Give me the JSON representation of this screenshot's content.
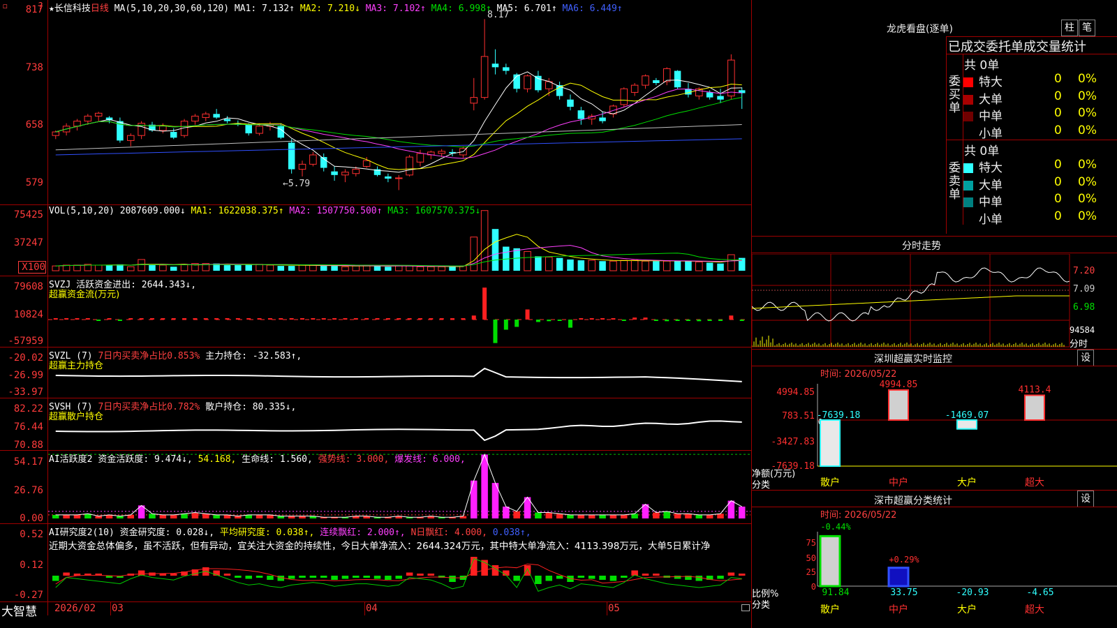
{
  "stock": {
    "name": "长信科技",
    "period": "日线",
    "star": "★",
    "peak_label": "8.17",
    "low_label": "5.79"
  },
  "ma": {
    "label": "MA(5,10,20,30,60,120)",
    "ma1": "MA1: 7.132↑",
    "ma2": "MA2: 7.210↓",
    "ma3": "MA3: 7.102↑",
    "ma4": "MA4: 6.998↑",
    "ma5": "MA5: 6.701↑",
    "ma6": "MA6: 6.449↑"
  },
  "price_axis": [
    "817",
    "738",
    "658",
    "579"
  ],
  "vol": {
    "label": "VOL(5,10,20)",
    "value": "2087609.000↓",
    "ma1": "MA1: 1622038.375↑",
    "ma2": "MA2: 1507750.500↑",
    "ma3": "MA3: 1607570.375↓",
    "axis": [
      "75425",
      "37247",
      "X100"
    ]
  },
  "svzj": {
    "label": "SVZJ",
    "desc": "活跃资金进出: 2644.343↓,",
    "sub": "超赢资金流(万元)",
    "axis": [
      "79608",
      "10824",
      "-57959"
    ]
  },
  "svzl": {
    "label": "SVZL  (7)",
    "ratio": "7日内买卖净占比0.853%",
    "hold": "主力持仓: -32.583↑,",
    "sub": "超赢主力持仓",
    "axis": [
      "-20.02",
      "-26.99",
      "-33.97"
    ]
  },
  "svsh": {
    "label": "SVSH  (7)",
    "ratio": "7日内买卖净占比0.782%",
    "hold": "散户持仓: 80.335↓,",
    "sub": "超赢散户持仓",
    "axis": [
      "82.22",
      "76.44",
      "70.88"
    ]
  },
  "ai_act": {
    "label": "AI活跃度2",
    "a": "资金活跃度: 9.474↓,",
    "b": "54.168,",
    "c": "生命线: 1.560,",
    "d": "强势线: 3.000,",
    "e": "爆发线: 6.000,",
    "axis": [
      "54.17",
      "26.76",
      "0.00"
    ]
  },
  "ai_res": {
    "label": "AI研究度2(10)",
    "a": "资金研究度: 0.028↓,",
    "b": "平均研究度: 0.038↑,",
    "c": "连续飘红: 2.000↑,",
    "d": "N日飘红: 4.000,",
    "e": "0.038↑,",
    "commentary": "近期大资金总体偏多，虽不活跃，但有异动，宜关注大资金的持续性，今日大单净流入：2644.324万元，其中特大单净流入：4113.398万元，大单5日累计净",
    "axis": [
      "0.52",
      "0.12",
      "-0.27"
    ]
  },
  "timeline": {
    "brand": "大智慧",
    "labels": [
      "2026/02",
      "03",
      "04",
      "05"
    ]
  },
  "right": {
    "title": "龙虎看盘(逐单)",
    "btn1": "柱",
    "btn2": "笔",
    "stat_title": "已成交委托单成交量统计",
    "buy": {
      "side": "委买单",
      "total": "共 0单",
      "rows": [
        {
          "name": "特大",
          "v": "0",
          "p": "0%"
        },
        {
          "name": "大单",
          "v": "0",
          "p": "0%"
        },
        {
          "name": "中单",
          "v": "0",
          "p": "0%"
        },
        {
          "name": "小单",
          "v": "0",
          "p": "0%"
        }
      ]
    },
    "sell": {
      "side": "委卖单",
      "total": "共 0单",
      "rows": [
        {
          "name": "特大",
          "v": "0",
          "p": "0%"
        },
        {
          "name": "大单",
          "v": "0",
          "p": "0%"
        },
        {
          "name": "中单",
          "v": "0",
          "p": "0%"
        },
        {
          "name": "小单",
          "v": "0",
          "p": "0%"
        }
      ]
    },
    "fenshi": {
      "title": "分时走势",
      "axis": [
        "7.20",
        "7.09",
        "6.98"
      ],
      "vol": "94584",
      "tag": "分时"
    },
    "sz": {
      "title": "深圳超赢实时监控",
      "btn": "设",
      "time": "时间: 2026/05/22",
      "axis": [
        "4994.85",
        "783.51",
        "-3427.83",
        "-7639.18"
      ],
      "zero": "0",
      "ylabel": "净额(万元)",
      "xlabel": "分类",
      "bars": [
        {
          "cat": "散户",
          "val": "-7639.18"
        },
        {
          "cat": "中户",
          "val": "4994.85"
        },
        {
          "cat": "大户",
          "val": "-1469.07"
        },
        {
          "cat": "超大",
          "val": "4113.4"
        }
      ]
    },
    "ss": {
      "title": "深市超赢分类统计",
      "btn": "设",
      "time": "时间: 2026/05/22",
      "axis": [
        "75",
        "50",
        "25",
        "0"
      ],
      "ylabel": "比例%",
      "xlabel": "分类",
      "bars": [
        {
          "cat": "散户",
          "top": "-0.44%",
          "bottom": "91.84"
        },
        {
          "cat": "中户",
          "top": "+0.29%",
          "bottom": "33.75"
        },
        {
          "cat": "大户",
          "top": "",
          "bottom": "-20.93"
        },
        {
          "cat": "超大",
          "top": "",
          "bottom": "-4.65"
        }
      ]
    }
  },
  "chart_data": {
    "type": "candlestick",
    "title": "长信科技 日线",
    "ylim": [
      5.6,
      8.3
    ],
    "ohlc": [
      [
        6.55,
        6.62,
        6.5,
        6.6
      ],
      [
        6.6,
        6.72,
        6.55,
        6.68
      ],
      [
        6.68,
        6.78,
        6.62,
        6.75
      ],
      [
        6.75,
        6.85,
        6.7,
        6.82
      ],
      [
        6.82,
        6.88,
        6.75,
        6.86
      ],
      [
        6.8,
        6.82,
        6.72,
        6.76
      ],
      [
        6.75,
        6.8,
        6.45,
        6.48
      ],
      [
        6.48,
        6.58,
        6.4,
        6.55
      ],
      [
        6.55,
        6.75,
        6.5,
        6.72
      ],
      [
        6.7,
        6.74,
        6.6,
        6.62
      ],
      [
        6.62,
        6.72,
        6.58,
        6.68
      ],
      [
        6.6,
        6.65,
        6.5,
        6.52
      ],
      [
        6.55,
        6.78,
        6.52,
        6.75
      ],
      [
        6.75,
        6.85,
        6.7,
        6.82
      ],
      [
        6.8,
        6.88,
        6.75,
        6.85
      ],
      [
        6.85,
        6.92,
        6.78,
        6.8
      ],
      [
        6.78,
        6.82,
        6.72,
        6.75
      ],
      [
        6.72,
        6.76,
        6.68,
        6.7
      ],
      [
        6.7,
        6.72,
        6.55,
        6.58
      ],
      [
        6.58,
        6.72,
        6.55,
        6.68
      ],
      [
        6.68,
        6.74,
        6.62,
        6.7
      ],
      [
        6.68,
        6.72,
        6.5,
        6.52
      ],
      [
        6.45,
        6.5,
        6.02,
        6.08
      ],
      [
        6.08,
        6.2,
        5.98,
        6.15
      ],
      [
        6.15,
        6.32,
        6.12,
        6.28
      ],
      [
        6.25,
        6.3,
        6.05,
        6.1
      ],
      [
        6.05,
        6.12,
        5.92,
        6.0
      ],
      [
        6.0,
        6.08,
        5.9,
        6.04
      ],
      [
        6.02,
        6.12,
        5.98,
        6.08
      ],
      [
        6.12,
        6.25,
        6.1,
        6.2
      ],
      [
        6.08,
        6.12,
        5.98,
        6.0
      ],
      [
        5.98,
        6.02,
        5.9,
        5.95
      ],
      [
        5.95,
        6.0,
        5.79,
        5.96
      ],
      [
        6.0,
        6.28,
        5.98,
        6.25
      ],
      [
        6.18,
        6.35,
        6.12,
        6.3
      ],
      [
        6.28,
        6.34,
        6.22,
        6.32
      ],
      [
        6.3,
        6.36,
        6.25,
        6.33
      ],
      [
        6.32,
        6.36,
        6.26,
        6.3
      ],
      [
        6.28,
        6.4,
        6.24,
        6.37
      ],
      [
        7.0,
        7.35,
        6.9,
        7.08
      ],
      [
        7.08,
        8.17,
        7.05,
        7.65
      ],
      [
        7.55,
        7.75,
        7.4,
        7.5
      ],
      [
        7.5,
        7.55,
        7.4,
        7.45
      ],
      [
        7.4,
        7.42,
        7.15,
        7.2
      ],
      [
        7.2,
        7.4,
        7.15,
        7.38
      ],
      [
        7.38,
        7.45,
        7.15,
        7.18
      ],
      [
        7.2,
        7.35,
        7.1,
        7.3
      ],
      [
        7.25,
        7.3,
        7.05,
        7.1
      ],
      [
        7.05,
        7.12,
        6.9,
        6.95
      ],
      [
        6.9,
        6.95,
        6.7,
        6.78
      ],
      [
        6.78,
        6.85,
        6.7,
        6.82
      ],
      [
        6.8,
        6.88,
        6.72,
        6.75
      ],
      [
        6.85,
        6.98,
        6.8,
        6.96
      ],
      [
        6.98,
        7.22,
        6.95,
        7.2
      ],
      [
        7.15,
        7.28,
        7.1,
        7.25
      ],
      [
        7.25,
        7.4,
        7.2,
        7.38
      ],
      [
        7.32,
        7.35,
        7.25,
        7.28
      ],
      [
        7.3,
        7.5,
        7.25,
        7.48
      ],
      [
        7.45,
        7.46,
        7.2,
        7.22
      ],
      [
        7.2,
        7.28,
        7.08,
        7.12
      ],
      [
        7.1,
        7.22,
        7.05,
        7.2
      ],
      [
        7.15,
        7.18,
        7.05,
        7.08
      ],
      [
        7.1,
        7.2,
        7.0,
        7.05
      ],
      [
        7.1,
        7.68,
        7.05,
        7.6
      ],
      [
        7.18,
        7.22,
        6.92,
        7.14
      ]
    ],
    "volume_values": [
      6,
      7,
      7,
      8,
      7,
      7,
      8,
      5,
      14,
      7,
      7,
      5,
      8,
      9,
      9,
      9,
      7,
      7,
      8,
      8,
      7,
      6,
      6,
      7,
      7,
      6,
      6,
      5,
      6,
      7,
      6,
      5,
      6,
      6,
      5,
      5,
      5,
      5,
      6,
      42,
      75,
      52,
      30,
      28,
      24,
      18,
      17,
      16,
      14,
      13,
      13,
      12,
      12,
      13,
      13,
      12,
      12,
      12,
      12,
      12,
      11,
      10,
      9,
      20,
      16
    ],
    "svzj_values": [
      0,
      0,
      0,
      0,
      -2,
      0,
      -2,
      0,
      0,
      0,
      0,
      0,
      0,
      0,
      0,
      0,
      0,
      0,
      0,
      0,
      0,
      0,
      0,
      0,
      0,
      0,
      0,
      0,
      0,
      0,
      0,
      0,
      0,
      0,
      0,
      0,
      0,
      0,
      0,
      10,
      79,
      -58,
      -25,
      -18,
      25,
      -6,
      -4,
      -3,
      -20,
      0,
      0,
      0,
      0,
      -2,
      5,
      5,
      -2,
      -4,
      -2,
      -2,
      -4,
      -2,
      -3,
      10,
      -3
    ],
    "active_values": [
      3,
      3,
      3,
      4,
      2,
      3,
      2,
      3,
      11,
      4,
      3,
      3,
      4,
      5,
      4,
      3,
      3,
      2,
      3,
      3,
      3,
      2,
      2,
      2,
      2,
      1,
      1,
      1,
      2,
      2,
      1,
      1,
      2,
      1,
      1,
      2,
      1,
      1,
      2,
      32,
      54,
      30,
      10,
      6,
      18,
      5,
      5,
      4,
      3,
      3,
      3,
      3,
      3,
      3,
      4,
      12,
      5,
      6,
      4,
      4,
      3,
      3,
      4,
      15,
      10
    ],
    "research_values": [
      -0.05,
      0.03,
      0.02,
      0.01,
      0.0,
      -0.01,
      -0.02,
      0.02,
      0.05,
      0.03,
      0.02,
      0.01,
      0.04,
      0.06,
      0.08,
      0.05,
      0.02,
      -0.01,
      -0.03,
      -0.02,
      -0.04,
      -0.05,
      -0.03,
      -0.02,
      -0.01,
      -0.02,
      -0.04,
      -0.03,
      -0.02,
      -0.02,
      -0.03,
      -0.04,
      -0.03,
      0.03,
      0.02,
      0.01,
      -0.02,
      -0.06,
      -0.04,
      0.18,
      0.15,
      0.1,
      0.05,
      -0.05,
      0.1,
      -0.08,
      -0.05,
      -0.03,
      -0.06,
      -0.02,
      -0.03,
      -0.04,
      -0.05,
      -0.01,
      0.05,
      0.02,
      0.0,
      -0.02,
      -0.03,
      -0.04,
      -0.05,
      -0.04,
      -0.03,
      0.03,
      0.02
    ]
  }
}
